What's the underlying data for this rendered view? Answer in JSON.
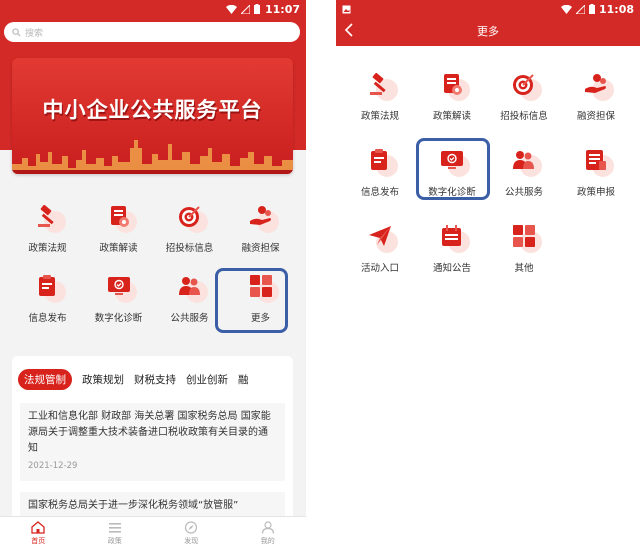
{
  "left": {
    "status_time": "11:07",
    "search_placeholder": "搜索",
    "banner_title": "中小企业公共服务平台",
    "menu": [
      {
        "label": "政策法规",
        "icon": "gavel-icon"
      },
      {
        "label": "政策解读",
        "icon": "document-gear-icon"
      },
      {
        "label": "招投标信息",
        "icon": "target-icon"
      },
      {
        "label": "融资担保",
        "icon": "hand-coins-icon"
      },
      {
        "label": "信息发布",
        "icon": "clipboard-icon"
      },
      {
        "label": "数字化诊断",
        "icon": "monitor-check-icon"
      },
      {
        "label": "公共服务",
        "icon": "people-icon"
      },
      {
        "label": "更多",
        "icon": "grid-icon"
      }
    ],
    "tabs": [
      "法规管制",
      "政策规划",
      "财税支持",
      "创业创新",
      "融"
    ],
    "articles": [
      {
        "title": "工业和信息化部 财政部 海关总署 国家税务总局 国家能源局关于调整重大技术装备进口税收政策有关目录的通知",
        "date": "2021-12-29"
      },
      {
        "title": "国家税务总局关于进一步深化税务领域“放管服”",
        "date": ""
      }
    ],
    "bottom_nav": [
      "首页",
      "政策",
      "发现",
      "我的"
    ]
  },
  "right": {
    "status_time": "11:08",
    "title": "更多",
    "menu": [
      {
        "label": "政策法规",
        "icon": "gavel-icon"
      },
      {
        "label": "政策解读",
        "icon": "document-gear-icon"
      },
      {
        "label": "招投标信息",
        "icon": "target-icon"
      },
      {
        "label": "融资担保",
        "icon": "hand-coins-icon"
      },
      {
        "label": "信息发布",
        "icon": "clipboard-icon"
      },
      {
        "label": "数字化诊断",
        "icon": "monitor-check-icon"
      },
      {
        "label": "公共服务",
        "icon": "people-icon"
      },
      {
        "label": "政策申报",
        "icon": "form-icon"
      },
      {
        "label": "活动入口",
        "icon": "paper-plane-icon"
      },
      {
        "label": "通知公告",
        "icon": "calendar-icon"
      },
      {
        "label": "其他",
        "icon": "grid-icon"
      }
    ]
  },
  "colors": {
    "brand_red": "#d42a27",
    "highlight_blue": "#3b5ea7"
  }
}
